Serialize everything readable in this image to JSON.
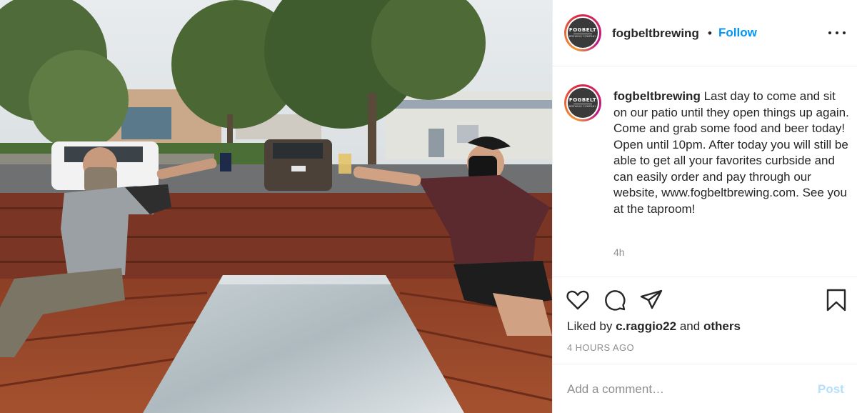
{
  "photo": {
    "description_icon": "photo-image"
  },
  "header": {
    "username": "fogbeltbrewing",
    "separator": "•",
    "follow_label": "Follow",
    "more_icon": "more-dots-icon",
    "avatar_logo_text": "FOGBELT",
    "avatar_logo_subtext": "BREWING COMPANY"
  },
  "caption": {
    "username": "fogbeltbrewing",
    "text": "Last day to come and sit on our patio until they open things up again. Come and grab some food and beer today! Open until 10pm. After today you will still be able to get all your favorites curbside and can easily order and pay through our website, www.fogbeltbrewing.com. See you at the taproom!",
    "time": "4h"
  },
  "actions": {
    "like_icon": "heart-icon",
    "comment_icon": "comment-icon",
    "share_icon": "share-icon",
    "save_icon": "bookmark-icon"
  },
  "likes": {
    "prefix": "Liked by",
    "user": "c.raggio22",
    "conjunction": "and",
    "others": "others"
  },
  "post_time": "4 HOURS AGO",
  "comment": {
    "placeholder": "Add a comment…",
    "post_label": "Post"
  },
  "colors": {
    "accent": "#0095f6",
    "post_disabled": "#b2dffc",
    "muted": "#8e8e8e",
    "text": "#262626"
  }
}
